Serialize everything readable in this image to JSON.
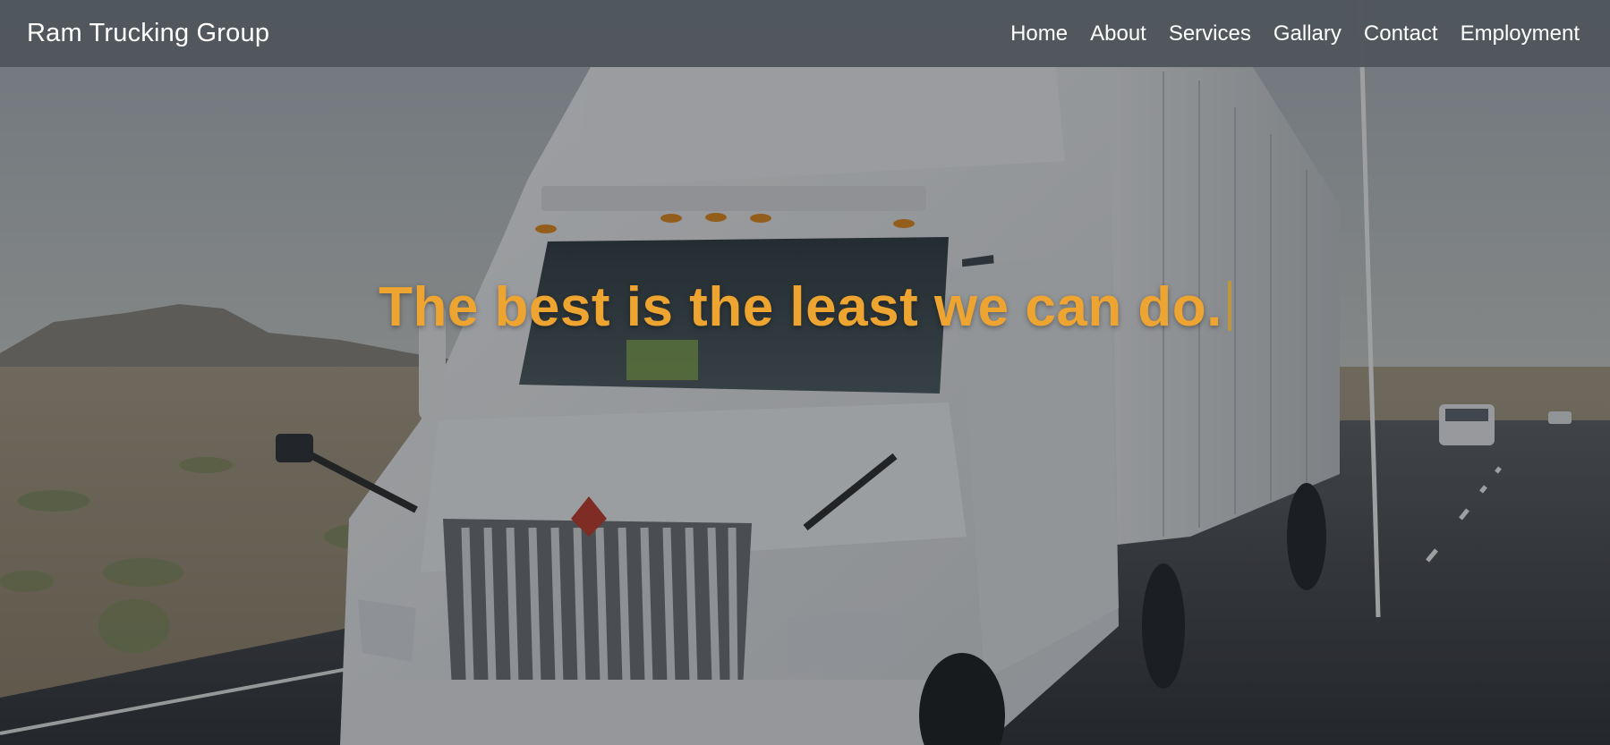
{
  "navbar": {
    "brand": "Ram Trucking Group",
    "links": [
      "Home",
      "About",
      "Services",
      "Gallary",
      "Contact",
      "Employment"
    ]
  },
  "hero": {
    "headline": "The best is the least we can do."
  },
  "colors": {
    "navbar_bg": "#50565c",
    "headline": "#eda431",
    "text": "#ffffff"
  }
}
